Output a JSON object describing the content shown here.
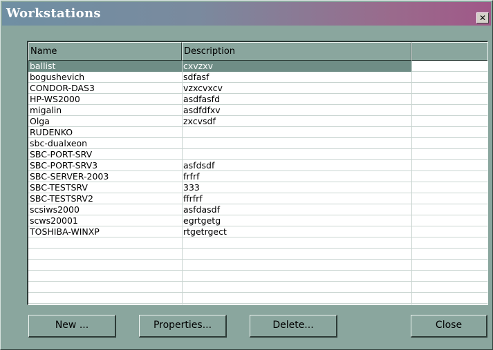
{
  "window": {
    "title": "Workstations",
    "close_glyph": "✕"
  },
  "list": {
    "columns": [
      "Name",
      "Description",
      ""
    ],
    "selected_index": 0,
    "rows": [
      {
        "name": "ballist",
        "description": "cxvzxv"
      },
      {
        "name": "bogushevich",
        "description": "sdfasf"
      },
      {
        "name": "CONDOR-DAS3",
        "description": "vzxcvxcv"
      },
      {
        "name": "HP-WS2000",
        "description": "asdfasfd"
      },
      {
        "name": "migalin",
        "description": "asdfdfxv"
      },
      {
        "name": "Olga",
        "description": "zxcvsdf"
      },
      {
        "name": "RUDENKO",
        "description": ""
      },
      {
        "name": "sbc-dualxeon",
        "description": ""
      },
      {
        "name": "SBC-PORT-SRV",
        "description": ""
      },
      {
        "name": "SBC-PORT-SRV3",
        "description": "asfdsdf"
      },
      {
        "name": "SBC-SERVER-2003",
        "description": "frfrf"
      },
      {
        "name": "SBC-TESTSRV",
        "description": "333"
      },
      {
        "name": "SBC-TESTSRV2",
        "description": "ffrfrf"
      },
      {
        "name": "scsiws2000",
        "description": "asfdasdf"
      },
      {
        "name": "scws20001",
        "description": "egrtgetg"
      },
      {
        "name": "TOSHIBA-WINXP",
        "description": "rtgetrgect"
      }
    ]
  },
  "buttons": {
    "new_label": "New ...",
    "properties_label": "Properties...",
    "delete_label": "Delete...",
    "close_label": "Close"
  }
}
